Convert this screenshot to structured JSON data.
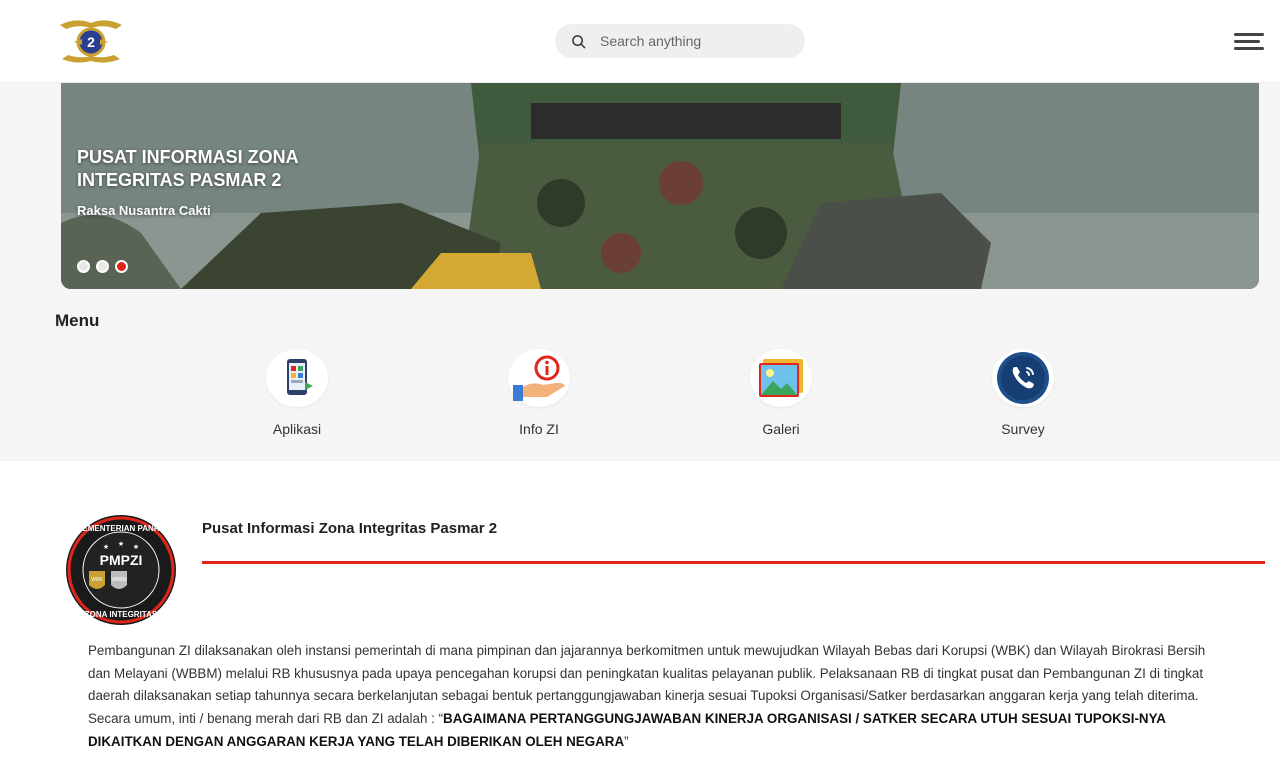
{
  "header": {
    "search_placeholder": "Search anything"
  },
  "hero": {
    "title": "PUSAT INFORMASI ZONA INTEGRITAS PASMAR 2",
    "subtitle": "Raksa Nusantra Cakti",
    "slides": 3,
    "active_slide": 3
  },
  "menu": {
    "title": "Menu",
    "items": [
      {
        "label": "Aplikasi"
      },
      {
        "label": "Info ZI"
      },
      {
        "label": "Galeri"
      },
      {
        "label": "Survey"
      }
    ]
  },
  "info": {
    "badge_top_text": "KEMENTERIAN PANRB",
    "badge_center_text": "PMPZI",
    "badge_bottom_text": "ZONA INTEGRITAS",
    "badge_left_shield": "WBK",
    "badge_right_shield": "WBBM",
    "title": "Pusat Informasi Zona Integritas Pasmar 2",
    "paragraph_main": "Pembangunan ZI dilaksanakan oleh instansi pemerintah di mana pimpinan dan jajarannya berkomitmen untuk mewujudkan Wilayah Bebas dari Korupsi (WBK) dan Wilayah Birokrasi Bersih dan Melayani (WBBM) melalui RB khususnya pada upaya pencegahan korupsi dan peningkatan kualitas pelayanan publik. Pelaksanaan RB di tingkat pusat dan Pembangunan ZI di tingkat daerah dilaksanakan setiap tahunnya secara berkelanjutan sebagai bentuk pertanggungjawaban kinerja sesuai Tupoksi Organisasi/Satker berdasarkan anggaran kerja yang telah diterima. Secara umum, inti / benang merah dari RB dan ZI adalah : “",
    "paragraph_bold": "BAGAIMANA PERTANGGUNGJAWABAN KINERJA ORGANISASI / SATKER SECARA UTUH SESUAI TUPOKSI-NYA DIKAITKAN DENGAN ANGGARAN KERJA YANG TELAH DIBERIKAN OLEH NEGARA",
    "paragraph_end": "”"
  },
  "colors": {
    "accent": "#e0261b",
    "gray_bg": "#f5f5f5"
  }
}
